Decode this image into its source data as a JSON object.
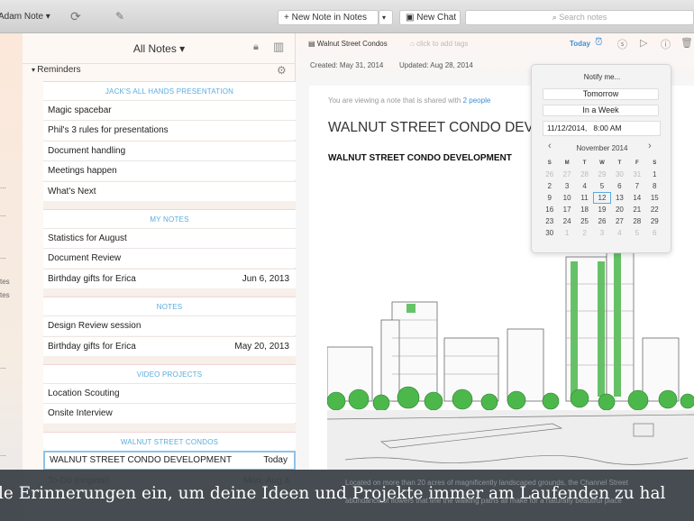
{
  "toolbar": {
    "account": "Adam Note ▾",
    "new_note": "New Note in Notes",
    "new_chat": "New Chat",
    "search_placeholder": "Search notes"
  },
  "sidebar": {
    "fragments": [
      "...",
      "...",
      "...",
      "...",
      "tes",
      "tes",
      "...",
      "..."
    ]
  },
  "list": {
    "title": "All Notes ▾",
    "reminders_label": "Reminders",
    "sections": [
      {
        "header": "JACK'S ALL HANDS PRESENTATION",
        "rows": [
          {
            "title": "Magic spacebar",
            "date": ""
          },
          {
            "title": "Phil's 3 rules for presentations",
            "date": ""
          },
          {
            "title": "Document handling",
            "date": ""
          },
          {
            "title": "Meetings happen",
            "date": ""
          },
          {
            "title": "What's Next",
            "date": ""
          }
        ]
      },
      {
        "header": "MY NOTES",
        "rows": [
          {
            "title": "Statistics for August",
            "date": ""
          },
          {
            "title": "Document Review",
            "date": ""
          },
          {
            "title": "Birthday gifts for Erica",
            "date": "Jun 6, 2013"
          }
        ]
      },
      {
        "header": "NOTES",
        "rows": [
          {
            "title": "Design Review session",
            "date": ""
          },
          {
            "title": "Birthday gifts for Erica",
            "date": "May 20, 2013"
          }
        ]
      },
      {
        "header": "VIDEO PROJECTS",
        "rows": [
          {
            "title": "Location Scouting",
            "date": ""
          },
          {
            "title": "Onsite Interview",
            "date": ""
          }
        ]
      },
      {
        "header": "WALNUT STREET CONDOS",
        "rows": [
          {
            "title": "WALNUT STREET CONDO DEVELOPMENT",
            "date": "Today"
          },
          {
            "title": "To-Do (original)",
            "date": "Mon, Aug 4"
          }
        ]
      }
    ]
  },
  "note": {
    "notebook": "Walnut Street Condos",
    "tags_placeholder": "click to add tags",
    "reminder_label": "Today",
    "created": "Created: May 31, 2014",
    "updated": "Updated: Aug 28, 2014",
    "shared_text": "You are viewing a note that is shared with",
    "shared_link": "2 people",
    "heading": "WALNUT STREET CONDO DEVELOPMENT",
    "subheading": "WALNUT STREET CONDO DEVELOPMENT",
    "body1": "Located on more than 20 acres of magnificently landscaped grounds, the Channel Street",
    "body2": "abundance of flowers that line the walking paths all make for a naturally beautiful place"
  },
  "popover": {
    "title": "Notify me...",
    "tomorrow": "Tomorrow",
    "week": "In a Week",
    "datetime": "11/12/2014,   8:00 AM",
    "month": "November 2014",
    "weekdays": [
      "S",
      "M",
      "T",
      "W",
      "T",
      "F",
      "S"
    ],
    "weeks": [
      [
        "26",
        "27",
        "28",
        "29",
        "30",
        "31",
        "1"
      ],
      [
        "2",
        "3",
        "4",
        "5",
        "6",
        "7",
        "8"
      ],
      [
        "9",
        "10",
        "11",
        "12",
        "13",
        "14",
        "15"
      ],
      [
        "16",
        "17",
        "18",
        "19",
        "20",
        "21",
        "22"
      ],
      [
        "23",
        "24",
        "25",
        "26",
        "27",
        "28",
        "29"
      ],
      [
        "30",
        "1",
        "2",
        "3",
        "4",
        "5",
        "6"
      ]
    ],
    "selected": "12"
  },
  "banner": {
    "text": "le Erinnerungen ein, um deine Ideen und Projekte immer am Laufenden zu hal"
  },
  "colors": {
    "accent": "#5aacde",
    "tree_green": "#4cb84c",
    "banner": "#3c4248"
  }
}
